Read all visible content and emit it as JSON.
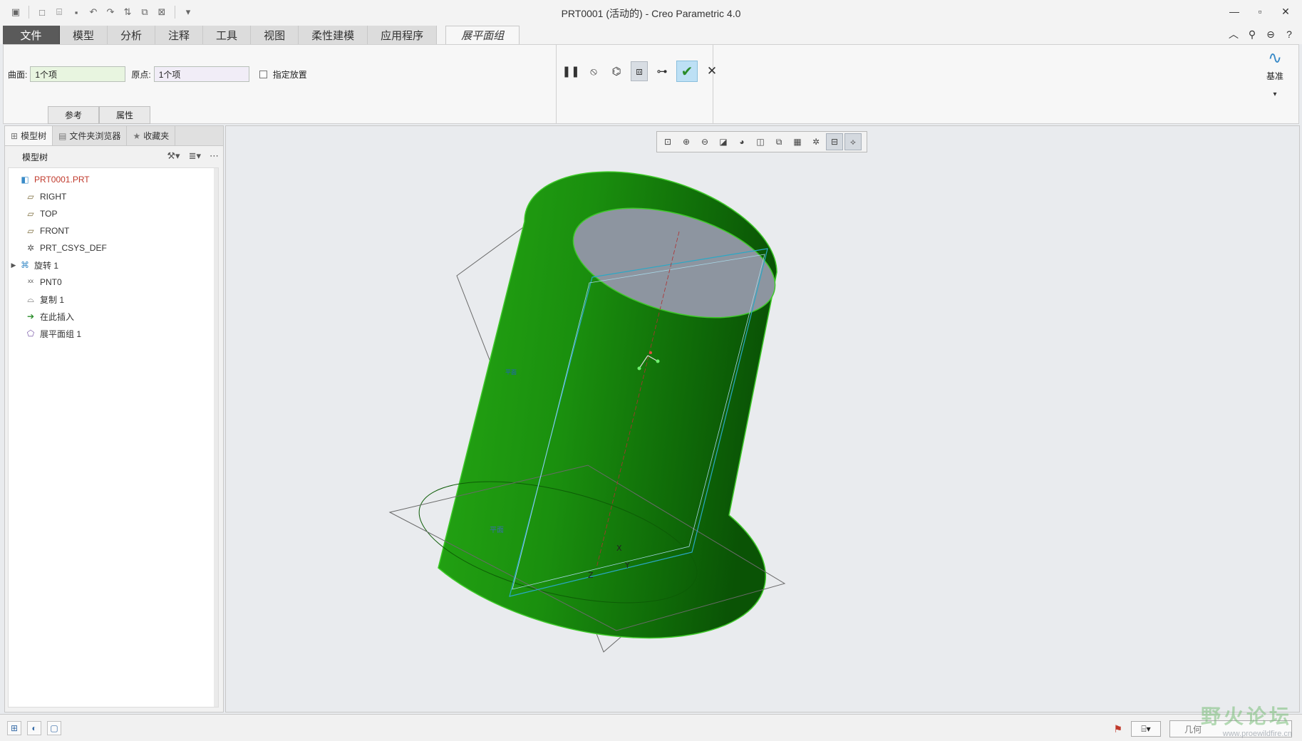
{
  "window": {
    "title": "PRT0001 (活动的) - Creo Parametric 4.0"
  },
  "ribbon_tabs": [
    "文件",
    "模型",
    "分析",
    "注释",
    "工具",
    "视图",
    "柔性建模",
    "应用程序"
  ],
  "active_tab": "展平面组",
  "flatten": {
    "surface_label": "曲面:",
    "surface_value": "1个项",
    "origin_label": "原点:",
    "origin_value": "1个项",
    "placement_label": "指定放置",
    "subtabs": [
      "参考",
      "属性"
    ]
  },
  "datum_label": "基准",
  "panel": {
    "tabs": [
      "模型树",
      "文件夹浏览器",
      "收藏夹"
    ],
    "tree_header": "模型树"
  },
  "model_tree": [
    {
      "label": "PRT0001.PRT",
      "icon": "part-icon"
    },
    {
      "label": "RIGHT",
      "icon": "datum-plane-icon"
    },
    {
      "label": "TOP",
      "icon": "datum-plane-icon"
    },
    {
      "label": "FRONT",
      "icon": "datum-plane-icon"
    },
    {
      "label": "PRT_CSYS_DEF",
      "icon": "csys-icon"
    },
    {
      "label": "旋转 1",
      "icon": "revolve-icon"
    },
    {
      "label": "PNT0",
      "icon": "datum-point-icon"
    },
    {
      "label": "复制 1",
      "icon": "copy-surface-icon"
    },
    {
      "label": "在此插入",
      "icon": "insert-arrow-icon"
    },
    {
      "label": "展平面组 1",
      "icon": "flatten-quilt-icon"
    }
  ],
  "graphics": {
    "labels": {
      "x": "X",
      "y": "Y",
      "z": "Z",
      "plane": "平面"
    },
    "colors": {
      "body": "#1f9a12",
      "top_face": "#8d95a0",
      "datum": "#5a5a5a",
      "highlight": "#2aa8c6"
    }
  },
  "status": {
    "filter_value": "几何"
  },
  "watermark": {
    "main": "野火论坛",
    "sub": "www.proewildfire.cn"
  }
}
